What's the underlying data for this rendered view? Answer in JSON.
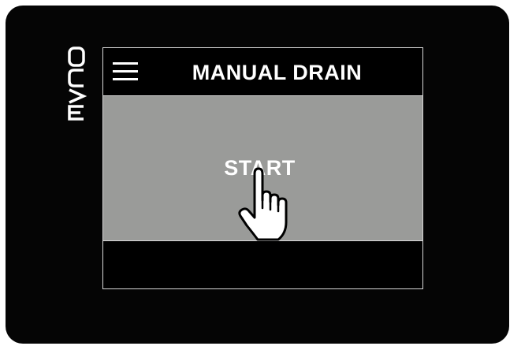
{
  "brand": {
    "logo_text": "EVCO",
    "icon": "evco-logo"
  },
  "header": {
    "menu_icon": "hamburger-menu-icon",
    "title": "MANUAL DRAIN"
  },
  "main": {
    "start_label": "START",
    "gesture_icon": "tap-hand-icon"
  },
  "colors": {
    "bezel": "#050505",
    "screen_bg": "#000000",
    "button_bg": "#9a9b99",
    "text": "#ffffff",
    "divider": "#d8d8d8"
  }
}
